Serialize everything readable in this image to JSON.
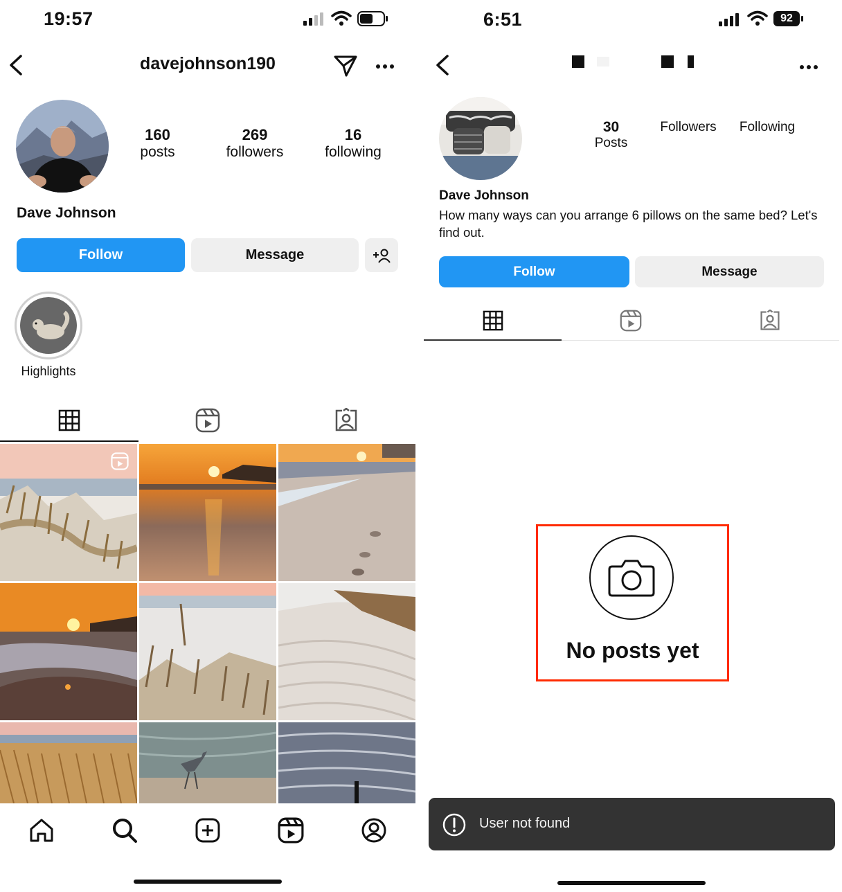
{
  "left": {
    "status": {
      "time": "19:57"
    },
    "header": {
      "username": "davejohnson190"
    },
    "stats": [
      {
        "value": "160",
        "label": "posts"
      },
      {
        "value": "269",
        "label": "followers"
      },
      {
        "value": "16",
        "label": "following"
      }
    ],
    "name": "Dave Johnson",
    "buttons": {
      "follow": "Follow",
      "message": "Message"
    },
    "highlight": {
      "label": "Highlights"
    },
    "tabs": [
      "grid-icon",
      "reels-icon",
      "tagged-icon"
    ],
    "bottom_nav": [
      "home-icon",
      "search-icon",
      "create-icon",
      "reels-icon",
      "profile-icon"
    ]
  },
  "right": {
    "status": {
      "time": "6:51",
      "battery": "92"
    },
    "stats": [
      {
        "value": "30",
        "label": "Posts"
      },
      {
        "label": "Followers"
      },
      {
        "label": "Following"
      }
    ],
    "name": "Dave Johnson",
    "bio": "How many ways can you arrange 6 pillows on the same bed? Let's find out.",
    "buttons": {
      "follow": "Follow",
      "message": "Message"
    },
    "empty": {
      "text": "No posts yet"
    },
    "toast": {
      "text": "User not found"
    }
  },
  "colors": {
    "accent": "#2196f3",
    "highlight_box": "#ff2a00",
    "toast_bg": "#333333"
  }
}
